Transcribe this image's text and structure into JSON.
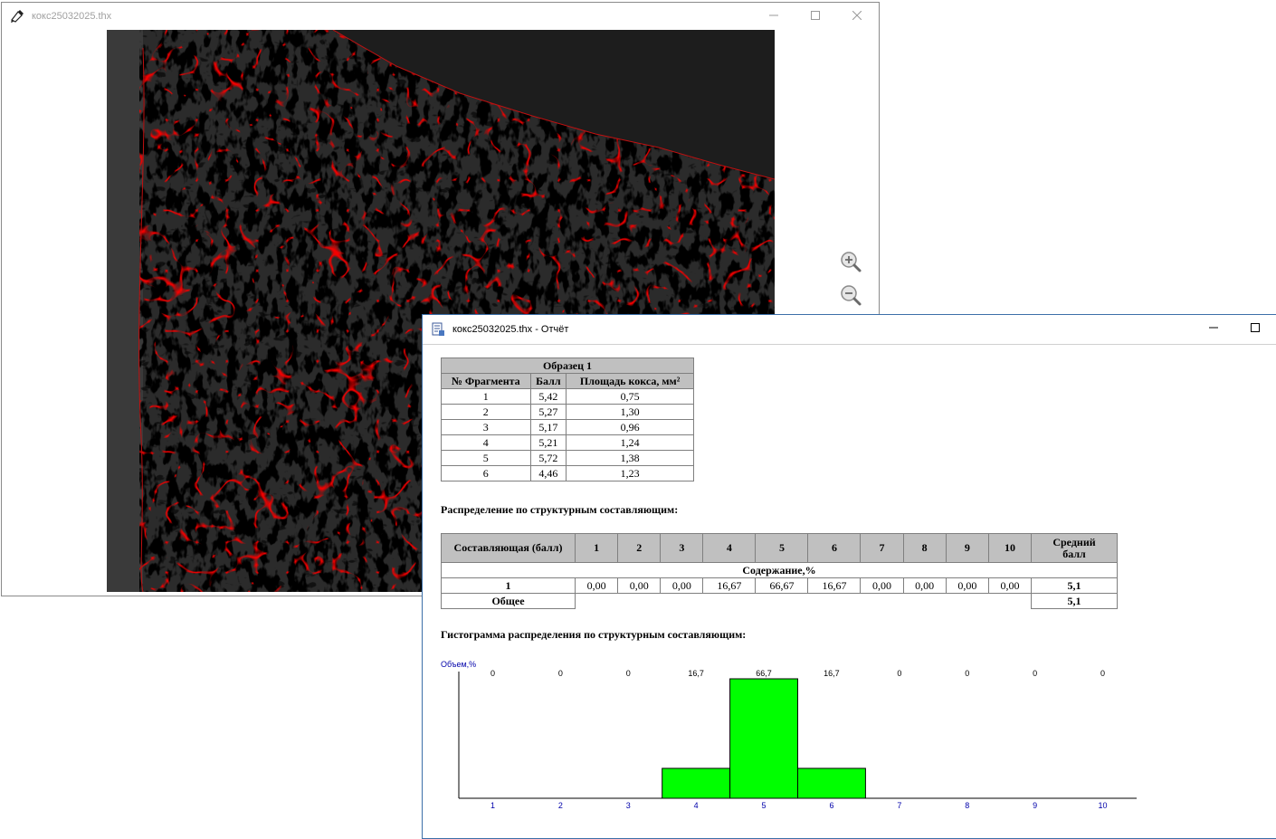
{
  "viewer": {
    "title": "кокс25032025.thx",
    "zoom_in_icon": "zoom-in-icon",
    "zoom_out_icon": "zoom-out-icon"
  },
  "report": {
    "title": "кокс25032025.thx - Отчёт",
    "sample_table": {
      "caption": "Образец 1",
      "headers": [
        "№ Фрагмента",
        "Балл",
        "Площадь кокса, мм²"
      ],
      "rows": [
        [
          "1",
          "5,42",
          "0,75"
        ],
        [
          "2",
          "5,27",
          "1,30"
        ],
        [
          "3",
          "5,17",
          "0,96"
        ],
        [
          "4",
          "5,21",
          "1,24"
        ],
        [
          "5",
          "5,72",
          "1,38"
        ],
        [
          "6",
          "4,46",
          "1,23"
        ]
      ]
    },
    "distribution": {
      "heading": "Распределение по структурным составляющим:",
      "col_header": "Составляющая (балл)",
      "score_columns": [
        "1",
        "2",
        "3",
        "4",
        "5",
        "6",
        "7",
        "8",
        "9",
        "10"
      ],
      "avg_header_line1": "Средний",
      "avg_header_line2": "балл",
      "content_label": "Содержание,%",
      "row_label": "1",
      "row_values": [
        "0,00",
        "0,00",
        "0,00",
        "16,67",
        "66,67",
        "16,67",
        "0,00",
        "0,00",
        "0,00",
        "0,00"
      ],
      "row_avg": "5,1",
      "total_label": "Общее",
      "total_avg": "5,1"
    },
    "histogram_heading": "Гистограмма распределения по структурным составляющим:"
  },
  "chart_data": {
    "type": "bar",
    "ylabel": "Объем,%",
    "categories": [
      "1",
      "2",
      "3",
      "4",
      "5",
      "6",
      "7",
      "8",
      "9",
      "10"
    ],
    "values": [
      0,
      0,
      0,
      16.7,
      66.7,
      16.7,
      0,
      0,
      0,
      0
    ],
    "value_labels": [
      "0",
      "0",
      "0",
      "16,7",
      "66,7",
      "16,7",
      "0",
      "0",
      "0",
      "0"
    ],
    "ylim": [
      0,
      66.7
    ],
    "bar_color": "#00ff00",
    "axis_label_color": "#0000aa"
  }
}
